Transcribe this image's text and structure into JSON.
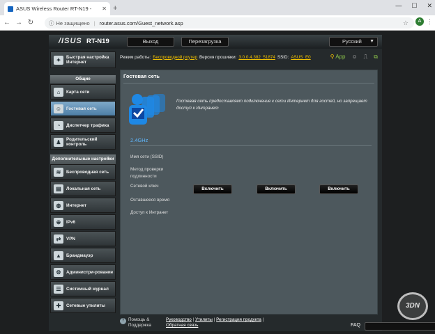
{
  "browser": {
    "tab_title": "ASUS Wireless Router RT-N19 -",
    "not_secure": "Не защищено",
    "url": "router.asus.com/Guest_network.asp",
    "avatar": "A"
  },
  "router": {
    "brand": "/ISUS",
    "model": "RT-N19",
    "logout": "Выход",
    "reboot": "Перезагрузка",
    "language": "Русский"
  },
  "status": {
    "mode_label": "Режим работы:",
    "mode_value": "Беспроводной роутер",
    "fw_label": "Версия прошивки:",
    "fw_value": "3.0.0.4.382_51874",
    "ssid_label": "SSID:",
    "ssid_value": "ASUS_E0",
    "app": "App"
  },
  "sidebar": {
    "quick": "Быстрая настройка Интернет",
    "general_header": "Общие",
    "general": [
      {
        "label": "Карта сети"
      },
      {
        "label": "Гостевая сеть"
      },
      {
        "label": "Диспетчер трафика"
      },
      {
        "label": "Родительский контроль"
      }
    ],
    "advanced_header": "Дополнительные настройки",
    "advanced": [
      {
        "label": "Беспроводная сеть"
      },
      {
        "label": "Локальная сеть"
      },
      {
        "label": "Интернет"
      },
      {
        "label": "IPv6"
      },
      {
        "label": "VPN"
      },
      {
        "label": "Брандмауэр"
      },
      {
        "label": "Администри-рование"
      },
      {
        "label": "Системный журнал"
      },
      {
        "label": "Сетевые утилиты"
      }
    ]
  },
  "content": {
    "title": "Гостевая сеть",
    "description": "Гостевая сеть предоставляет подключение к сети Интернет для гостей, но запрещает доступ к Интранет",
    "band": "2.4GHz",
    "labels": [
      "Имя сети (SSID)",
      "Метод проверки подлинности",
      "Сетевой ключ",
      "Оставшееся время",
      "Доступ к Интранет"
    ],
    "enable": "Включить"
  },
  "footer": {
    "help": "Помощь & Поддержка",
    "manual": "Руководство",
    "sep1": " | ",
    "utility": "Утилиты",
    "sep2": " | ",
    "registration": "Регистрация продукта",
    "sep3": " | ",
    "feedback": "Обратная связь",
    "faq": "FAQ"
  },
  "colors": {
    "accent": "#5fb8ff",
    "highlight": "#f2c100",
    "active_item": "#5f8fb5"
  }
}
